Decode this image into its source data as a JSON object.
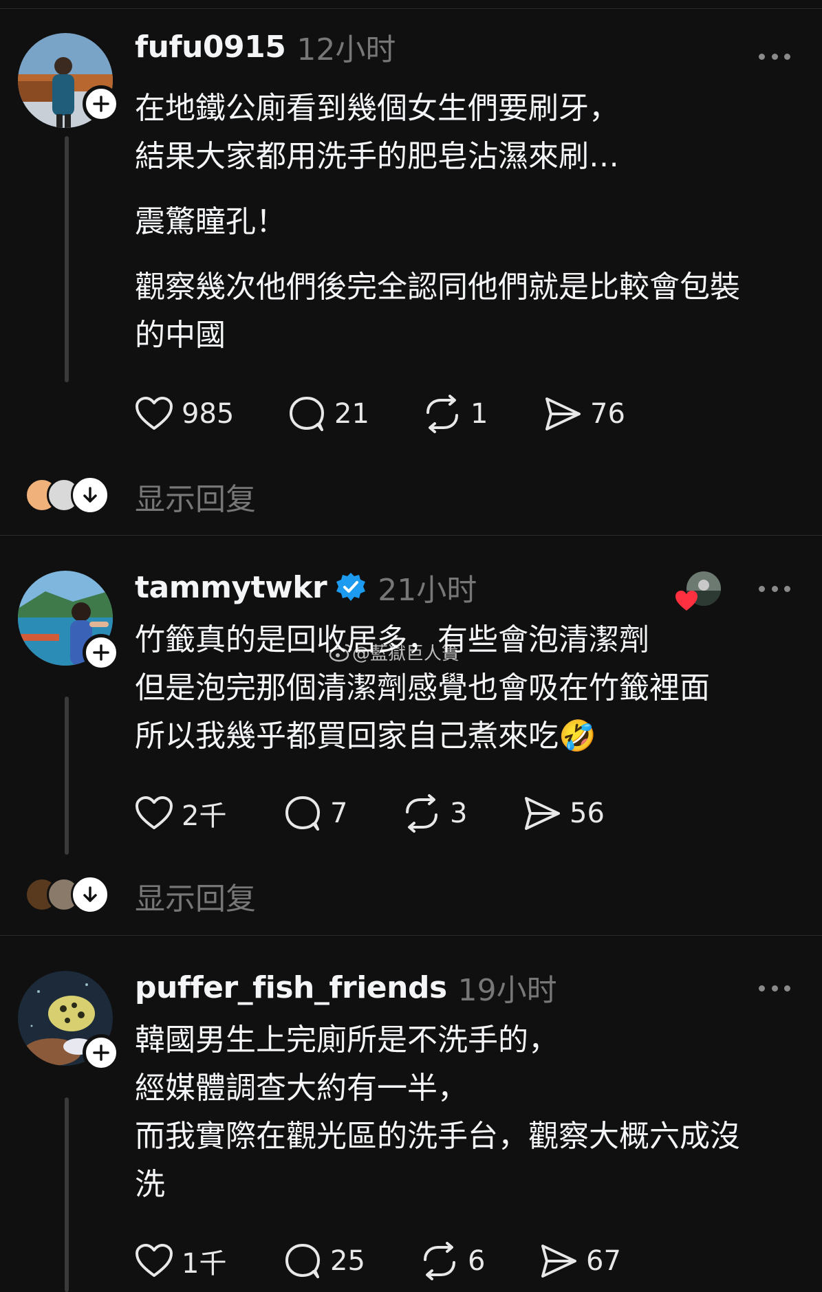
{
  "posts": [
    {
      "username": "fufu0915",
      "time": "12小时",
      "lines": [
        "在地鐵公廁看到幾個女生們要刷牙，",
        "結果大家都用洗手的肥皂沾濕來刷…",
        "震驚瞳孔！",
        "觀察幾次他們後完全認同他們就是比較會包裝",
        "的中國"
      ],
      "likes": "985",
      "comments": "21",
      "reposts": "1",
      "shares": "76",
      "show_replies": "显示回复"
    },
    {
      "username": "tammytwkr",
      "time": "21小时",
      "lines": [
        "竹籤真的是回收居多，有些會泡清潔劑",
        "但是泡完那個清潔劑感覺也會吸在竹籤裡面",
        "所以我幾乎都買回家自己煮來吃🤣"
      ],
      "likes": "2千",
      "comments": "7",
      "reposts": "3",
      "shares": "56",
      "show_replies": "显示回复"
    },
    {
      "username": "puffer_fish_friends",
      "time": "19小时",
      "lines": [
        "韓國男生上完廁所是不洗手的，",
        "經媒體調查大約有一半，",
        "而我實際在觀光區的洗手台，觀察大概六成沒",
        "洗"
      ],
      "likes": "1千",
      "comments": "25",
      "reposts": "6",
      "shares": "67"
    }
  ],
  "watermark": "@藍獄巨人簀",
  "icons": {
    "like": "heart-icon",
    "comment": "comment-bubble-icon",
    "repost": "repost-icon",
    "share": "send-icon",
    "more": "more-dots-icon",
    "follow": "plus-icon",
    "expand": "chevron-down-icon",
    "verified": "verified-badge-icon"
  }
}
